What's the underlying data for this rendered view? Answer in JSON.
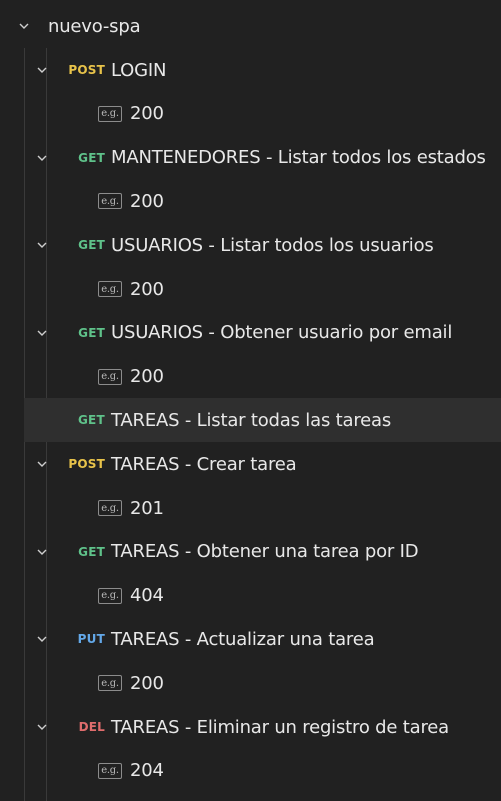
{
  "collection": {
    "name": "nuevo-spa",
    "requests": [
      {
        "method": "POST",
        "name": "LOGIN",
        "expanded": true,
        "examples": [
          {
            "badge": "e.g.",
            "status": "200"
          }
        ]
      },
      {
        "method": "GET",
        "name": "MANTENEDORES - Listar todos los estados",
        "expanded": true,
        "examples": [
          {
            "badge": "e.g.",
            "status": "200"
          }
        ]
      },
      {
        "method": "GET",
        "name": "USUARIOS - Listar todos los usuarios",
        "expanded": true,
        "examples": [
          {
            "badge": "e.g.",
            "status": "200"
          }
        ]
      },
      {
        "method": "GET",
        "name": "USUARIOS - Obtener usuario por email",
        "expanded": true,
        "examples": [
          {
            "badge": "e.g.",
            "status": "200"
          }
        ]
      },
      {
        "method": "GET",
        "name": "TAREAS - Listar todas las tareas",
        "expanded": false,
        "selected": true,
        "examples": []
      },
      {
        "method": "POST",
        "name": "TAREAS - Crear tarea",
        "expanded": true,
        "examples": [
          {
            "badge": "e.g.",
            "status": "201"
          }
        ]
      },
      {
        "method": "GET",
        "name": "TAREAS - Obtener una tarea por ID",
        "expanded": true,
        "examples": [
          {
            "badge": "e.g.",
            "status": "404"
          }
        ]
      },
      {
        "method": "PUT",
        "name": "TAREAS - Actualizar una tarea",
        "expanded": true,
        "examples": [
          {
            "badge": "e.g.",
            "status": "200"
          }
        ]
      },
      {
        "method": "DEL",
        "name": "TAREAS - Eliminar un registro de tarea",
        "expanded": true,
        "examples": [
          {
            "badge": "e.g.",
            "status": "204"
          }
        ]
      }
    ]
  },
  "colors": {
    "POST": "#e8c34a",
    "GET": "#5fc28a",
    "PUT": "#63a8e8",
    "DEL": "#e06c6c",
    "background": "#212121",
    "selected_row": "#2f2f2f"
  },
  "icons": {
    "expand": "chevron-down-icon",
    "example": "example-badge-icon"
  }
}
